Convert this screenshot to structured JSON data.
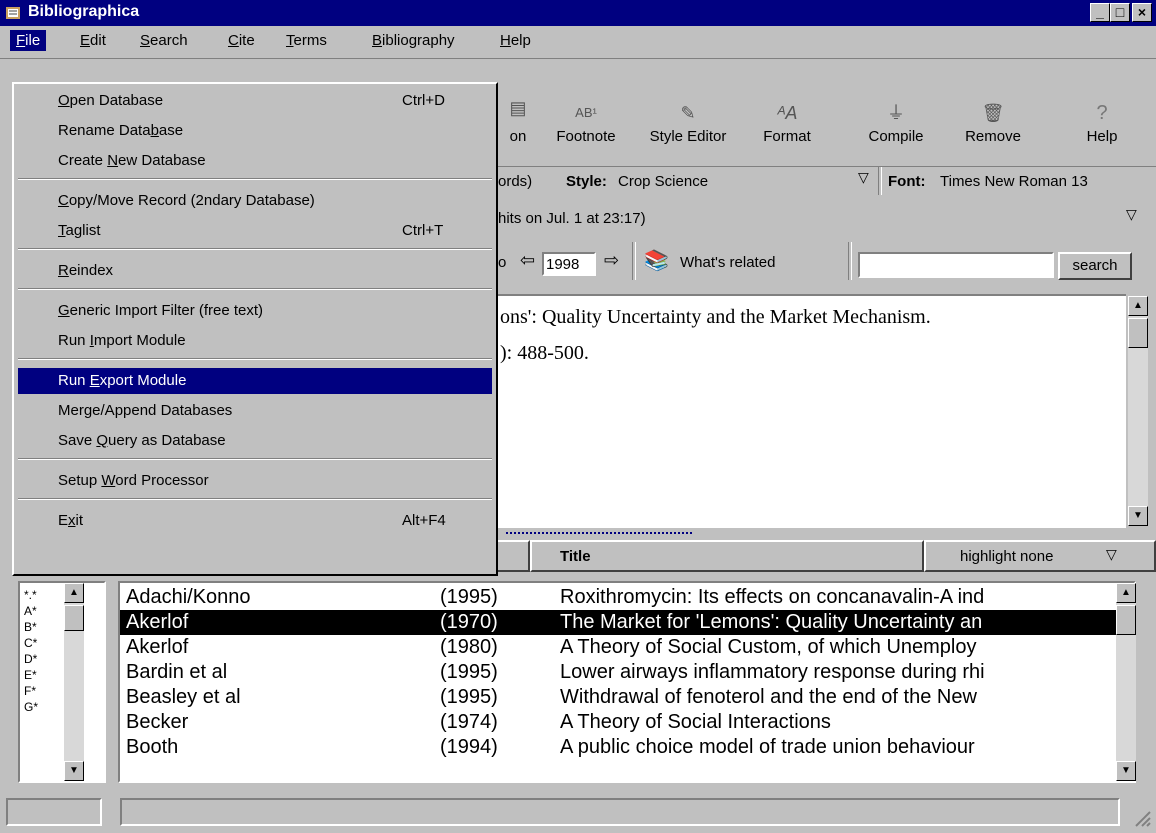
{
  "window": {
    "title": "Bibliographica",
    "minimize": "_",
    "maximize": "□",
    "close": "×"
  },
  "menubar": [
    {
      "pre": "",
      "u": "F",
      "post": "ile"
    },
    {
      "pre": "",
      "u": "E",
      "post": "dit"
    },
    {
      "pre": "",
      "u": "S",
      "post": "earch"
    },
    {
      "pre": "",
      "u": "C",
      "post": "ite"
    },
    {
      "pre": "",
      "u": "T",
      "post": "erms"
    },
    {
      "pre": "",
      "u": "B",
      "post": "ibliography"
    },
    {
      "pre": "",
      "u": "H",
      "post": "elp"
    }
  ],
  "file_menu": [
    {
      "pre": "",
      "u": "O",
      "post": "pen Database",
      "shortcut": "Ctrl+D"
    },
    {
      "pre": "Rename Data",
      "u": "b",
      "post": "ase",
      "shortcut": ""
    },
    {
      "pre": "Create ",
      "u": "N",
      "post": "ew Database",
      "shortcut": ""
    },
    {
      "pre": "",
      "u": "C",
      "post": "opy/Move Record (2ndary Database)",
      "shortcut": ""
    },
    {
      "pre": "",
      "u": "T",
      "post": "aglist",
      "shortcut": "Ctrl+T"
    },
    {
      "pre": "",
      "u": "R",
      "post": "eindex",
      "shortcut": ""
    },
    {
      "pre": "",
      "u": "G",
      "post": "eneric Import Filter (free text)",
      "shortcut": ""
    },
    {
      "pre": "Run ",
      "u": "I",
      "post": "mport Module",
      "shortcut": ""
    },
    {
      "pre": "Run ",
      "u": "E",
      "post": "xport Module",
      "shortcut": ""
    },
    {
      "pre": "Merge/Append Databases",
      "u": "",
      "post": "",
      "shortcut": ""
    },
    {
      "pre": "Save ",
      "u": "Q",
      "post": "uery as Database",
      "shortcut": ""
    },
    {
      "pre": "Setup ",
      "u": "W",
      "post": "ord Processor",
      "shortcut": ""
    },
    {
      "pre": "E",
      "u": "x",
      "post": "it",
      "shortcut": "Alt+F4"
    }
  ],
  "toolbar": [
    {
      "label": "on",
      "icon": "citation-icon"
    },
    {
      "label": "Footnote",
      "icon": "footnote-icon",
      "glyph": "AB¹"
    },
    {
      "label": "Style Editor",
      "icon": "style-editor-icon",
      "glyph": "✎"
    },
    {
      "label": "Format",
      "icon": "format-icon",
      "glyph": "ᴬA"
    },
    {
      "label": "Compile",
      "icon": "compile-icon",
      "glyph": "⏚"
    },
    {
      "label": "Remove",
      "icon": "remove-icon",
      "glyph": "🗑"
    },
    {
      "label": "Help",
      "icon": "help-icon",
      "glyph": "?"
    }
  ],
  "stylebar": {
    "records_suffix": "ords)",
    "style_label": "Style:",
    "style_value": "Crop Science",
    "font_label": "Font:",
    "font_value": "Times New Roman 13"
  },
  "dropbar": {
    "text": "hits on Jul. 1 at 23:17)"
  },
  "navbar": {
    "prefix": "o",
    "year": "1998",
    "related": "What's related",
    "search_value": "",
    "search_button": "search"
  },
  "reference": {
    "line1": "ons': Quality Uncertainty and the Market Mechanism.",
    "line2": "): 488-500."
  },
  "list_header": {
    "title": "Title",
    "highlight": "highlight none"
  },
  "letters": [
    "*.*",
    "A*",
    "B*",
    "C*",
    "D*",
    "E*",
    "F*",
    "G*"
  ],
  "records": [
    {
      "author": "Adachi/Konno",
      "year": "(1995)",
      "title": "Roxithromycin: Its effects on concanavalin-A ind"
    },
    {
      "author": "Akerlof",
      "year": "(1970)",
      "title": "The Market for 'Lemons': Quality Uncertainty an",
      "selected": true
    },
    {
      "author": "Akerlof",
      "year": "(1980)",
      "title": "A Theory of Social Custom, of which Unemploy"
    },
    {
      "author": "Bardin et al",
      "year": "(1995)",
      "title": "Lower airways inflammatory response during rhi"
    },
    {
      "author": "Beasley et al",
      "year": "(1995)",
      "title": "Withdrawal of fenoterol and the end of the New"
    },
    {
      "author": "Becker",
      "year": "(1974)",
      "title": "A Theory of Social Interactions"
    },
    {
      "author": "Booth",
      "year": "(1994)",
      "title": "A public choice model of trade union behaviour"
    }
  ],
  "colors": {
    "titlebar": "#000080",
    "face": "#c0c0c0",
    "selection": "#000080"
  }
}
